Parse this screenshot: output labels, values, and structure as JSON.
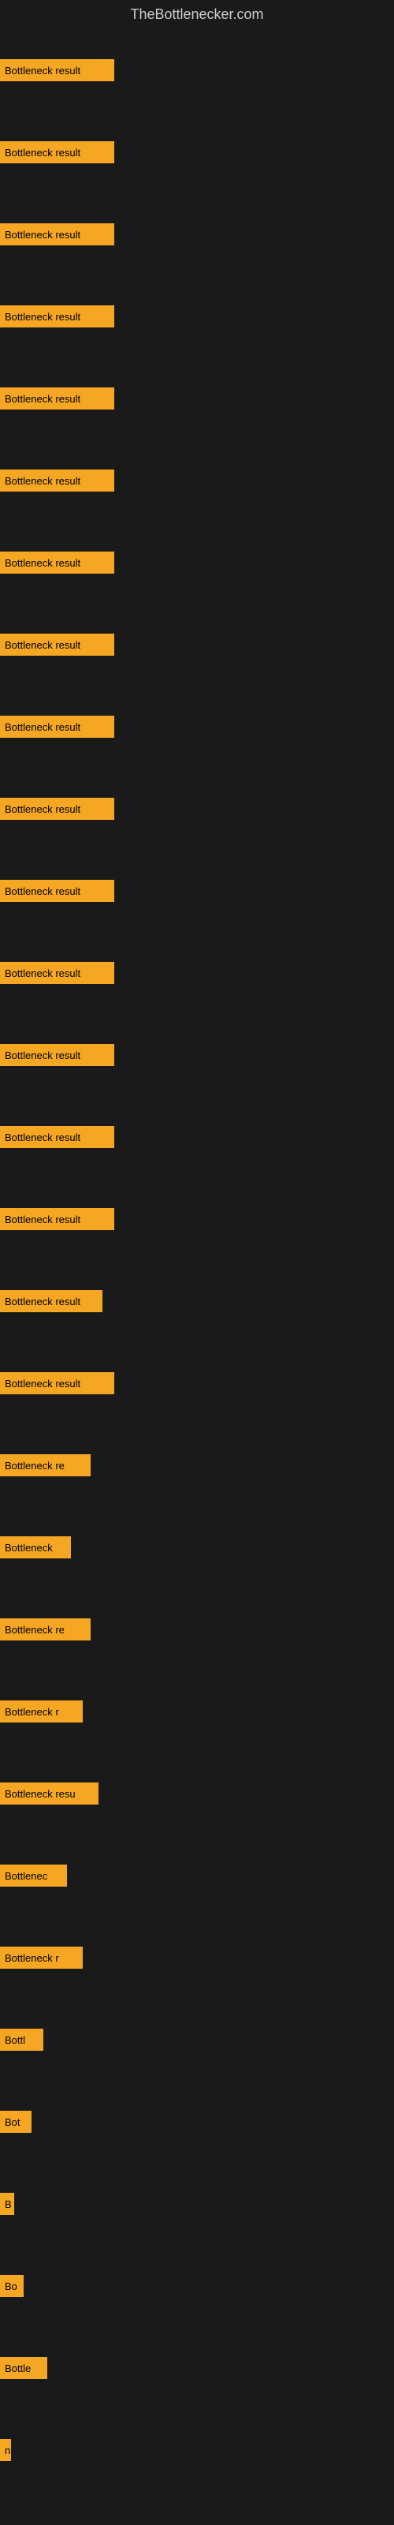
{
  "site_title": "TheBottlenecker.com",
  "bars": [
    {
      "label": "Bottleneck result",
      "width": 145
    },
    {
      "label": "Bottleneck result",
      "width": 145
    },
    {
      "label": "Bottleneck result",
      "width": 145
    },
    {
      "label": "Bottleneck result",
      "width": 145
    },
    {
      "label": "Bottleneck result",
      "width": 145
    },
    {
      "label": "Bottleneck result",
      "width": 145
    },
    {
      "label": "Bottleneck result",
      "width": 145
    },
    {
      "label": "Bottleneck result",
      "width": 145
    },
    {
      "label": "Bottleneck result",
      "width": 145
    },
    {
      "label": "Bottleneck result",
      "width": 145
    },
    {
      "label": "Bottleneck result",
      "width": 145
    },
    {
      "label": "Bottleneck result",
      "width": 145
    },
    {
      "label": "Bottleneck result",
      "width": 145
    },
    {
      "label": "Bottleneck result",
      "width": 145
    },
    {
      "label": "Bottleneck result",
      "width": 145
    },
    {
      "label": "Bottleneck result",
      "width": 130
    },
    {
      "label": "Bottleneck result",
      "width": 145
    },
    {
      "label": "Bottleneck re",
      "width": 115
    },
    {
      "label": "Bottleneck",
      "width": 90
    },
    {
      "label": "Bottleneck re",
      "width": 115
    },
    {
      "label": "Bottleneck r",
      "width": 105
    },
    {
      "label": "Bottleneck resu",
      "width": 125
    },
    {
      "label": "Bottlenec",
      "width": 85
    },
    {
      "label": "Bottleneck r",
      "width": 105
    },
    {
      "label": "Bottl",
      "width": 55
    },
    {
      "label": "Bot",
      "width": 40
    },
    {
      "label": "B",
      "width": 18
    },
    {
      "label": "Bo",
      "width": 30
    },
    {
      "label": "Bottle",
      "width": 60
    },
    {
      "label": "n",
      "width": 14
    }
  ],
  "colors": {
    "bar_bg": "#f5a623",
    "page_bg": "#1a1a1a",
    "title_color": "#cccccc"
  }
}
